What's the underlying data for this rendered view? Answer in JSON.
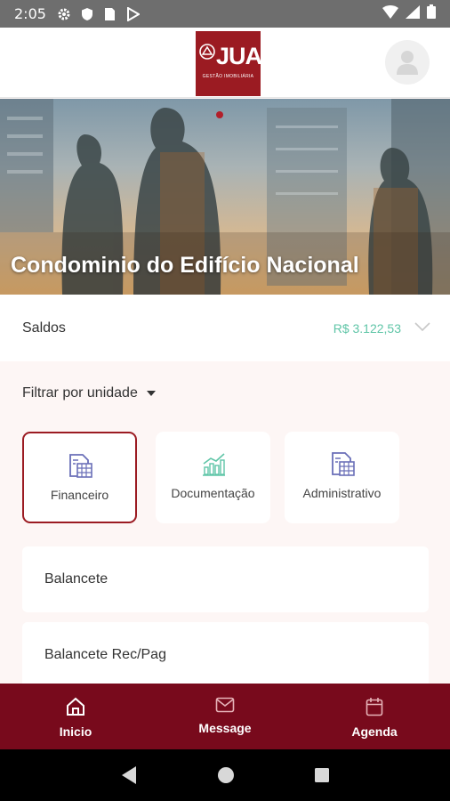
{
  "status_bar": {
    "time": "2:05"
  },
  "header": {
    "logo_text": "JUA",
    "logo_subtitle": "GESTÃO IMOBILIÁRIA"
  },
  "banner": {
    "title": "Condominio do Edifício Nacional"
  },
  "saldos": {
    "label": "Saldos",
    "value": "R$ 3.122,53"
  },
  "filter": {
    "label": "Filtrar por unidade"
  },
  "categories": [
    {
      "label": "Financeiro",
      "icon": "spreadsheet-icon",
      "active": true
    },
    {
      "label": "Documentação",
      "icon": "chart-icon",
      "active": false
    },
    {
      "label": "Administrativo",
      "icon": "spreadsheet-icon",
      "active": false
    }
  ],
  "list": [
    {
      "label": "Balancete"
    },
    {
      "label": "Balancete Rec/Pag"
    }
  ],
  "bottom_nav": [
    {
      "label": "Inicio",
      "icon": "home-icon"
    },
    {
      "label": "Message",
      "icon": "mail-icon"
    },
    {
      "label": "Agenda",
      "icon": "calendar-icon"
    }
  ],
  "colors": {
    "brand": "#9b1b22",
    "nav_bg": "#780a1c",
    "balance": "#5fc5a7"
  }
}
